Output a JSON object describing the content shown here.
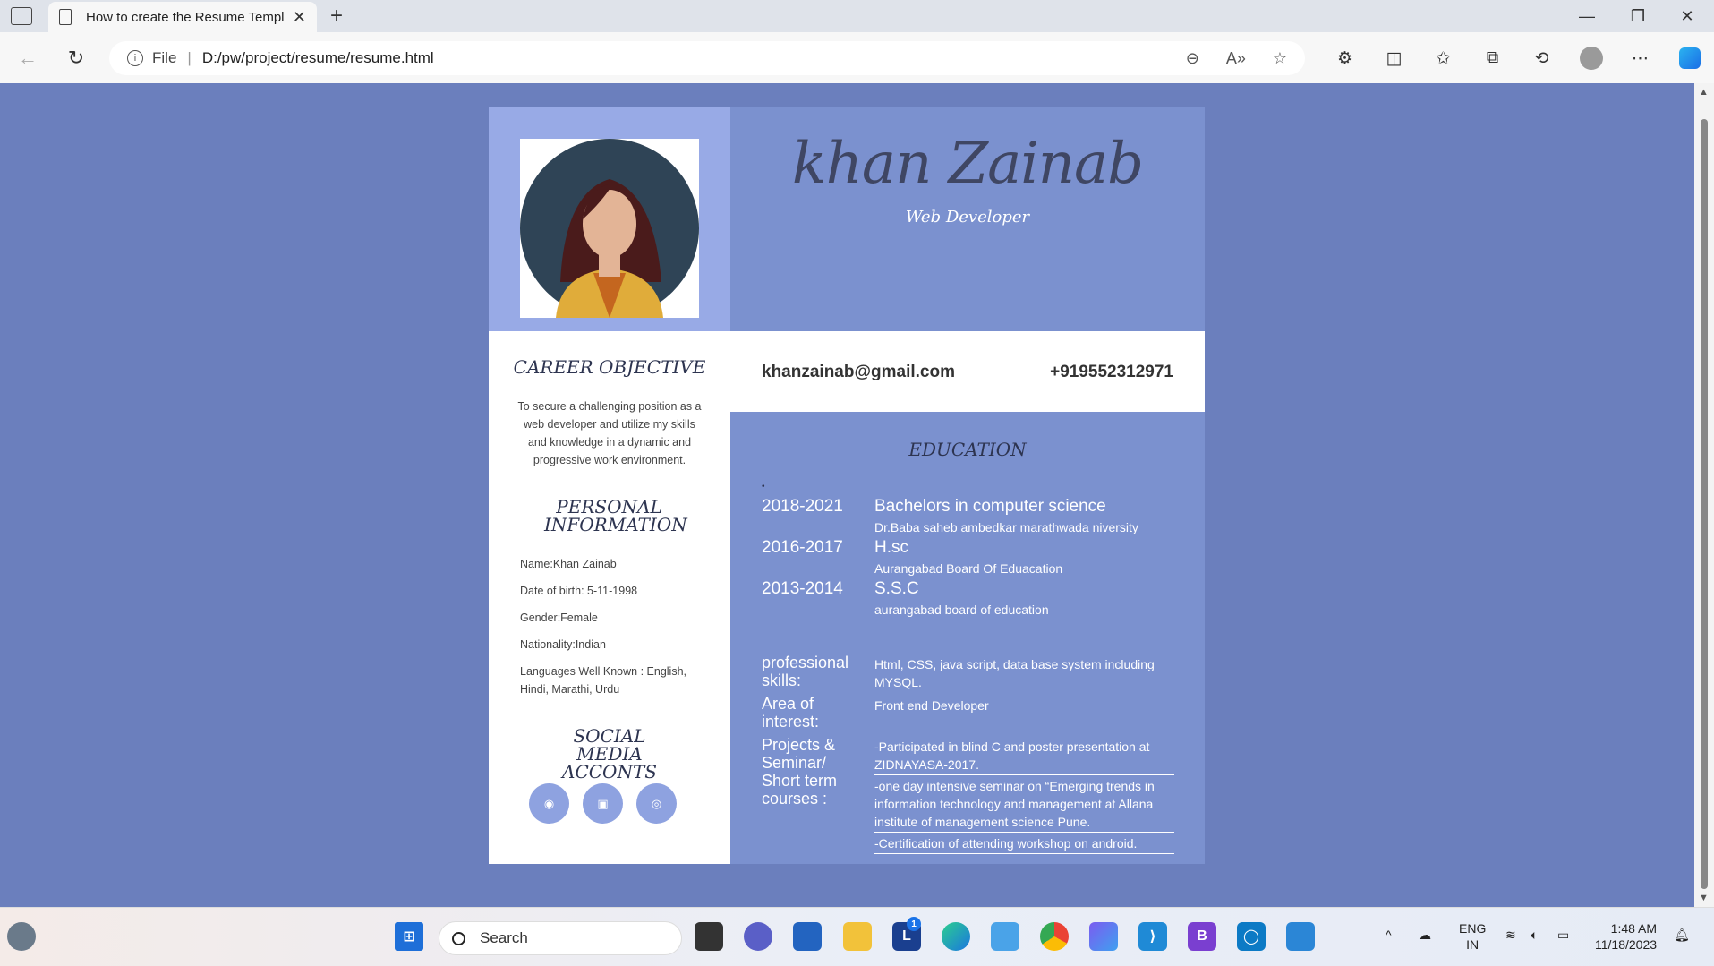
{
  "browser": {
    "tab_title": "How to create the Resume Templ",
    "address_label": "File",
    "address": "D:/pw/project/resume/resume.html"
  },
  "resume": {
    "name": "khan Zainab",
    "role": "Web Developer",
    "email": "khanzainab@gmail.com",
    "phone": "+919552312971",
    "career": {
      "title": "CAREER OBJECTIVE",
      "text": "To secure a challenging position as a web developer and utilize my skills and knowledge in a dynamic and progressive work environment."
    },
    "personal": {
      "title": "PERSONAL INFORMATION",
      "items": [
        "Name:Khan Zainab",
        "Date of birth: 5-11-1998",
        "Gender:Female",
        "Nationality:Indian",
        "Languages Well Known : English, Hindi, Marathi, Urdu"
      ]
    },
    "social": {
      "title": "SOCIAL MEDIA ACCONTS",
      "icons": [
        "github-icon",
        "linkedin-icon",
        "instagram-icon"
      ]
    },
    "education": {
      "title": "EDUCATION",
      "marker": "•",
      "rows": [
        {
          "year": "2018-2021",
          "degree": "Bachelors in computer science",
          "school": "Dr.Baba saheb ambedkar marathwada niversity"
        },
        {
          "year": "2016-2017",
          "degree": "H.sc",
          "school": "Aurangabad Board Of Eduacation"
        },
        {
          "year": "2013-2014",
          "degree": "S.S.C",
          "school": "aurangabad board of education"
        }
      ]
    },
    "skills": {
      "label": "professional skills:",
      "value": "Html, CSS, java script, data base system including MYSQL."
    },
    "interest": {
      "label": "Area of interest:",
      "value": "Front end Developer"
    },
    "projects": {
      "label": "Projects & Seminar/ Short term courses :",
      "items": [
        "-Participated in blind C and poster presentation at ZIDNAYASA-2017.",
        "-one day intensive seminar on “Emerging trends in information technology and management at Allana institute of management science Pune.",
        "-Certification of attending workshop on android."
      ]
    }
  },
  "taskbar": {
    "search_placeholder": "Search",
    "lang": "ENG",
    "region": "IN",
    "time": "1:48 AM",
    "date": "11/18/2023",
    "badge": "1"
  }
}
